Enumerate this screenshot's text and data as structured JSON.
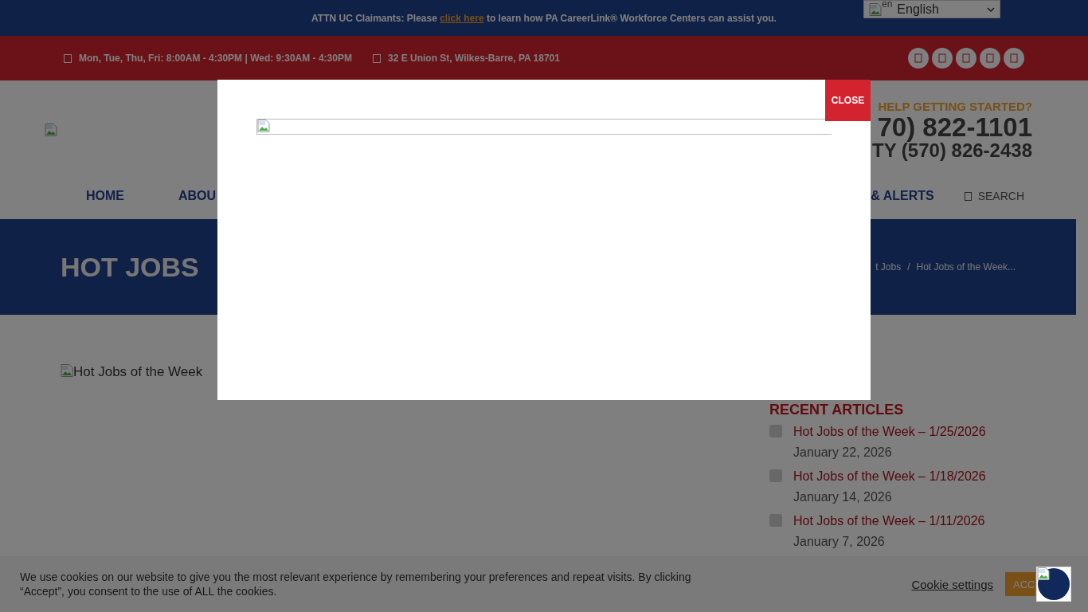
{
  "announcement": {
    "before": "ATTN UC Claimants: Please ",
    "link": "click here",
    "after": " to learn how PA CareerLink® Workforce Centers can assist you."
  },
  "language_select": {
    "flag_alt": "en",
    "value": "English"
  },
  "info_bar": {
    "hours": "Mon, Tue, Thu, Fri: 8:00AM - 4:30PM | Wed: 9:30AM - 4:30PM",
    "address": "32 E Union St, Wilkes-Barre, PA 18701"
  },
  "header": {
    "help": "HELP GETTING STARTED?",
    "phone": "70) 822-1101",
    "tty": "TY (570) 826-2438"
  },
  "nav": {
    "items": [
      {
        "label": "HOME"
      },
      {
        "label": "ABOU"
      }
    ],
    "right_items": [
      {
        "label": "& ALERTS"
      }
    ],
    "search": "SEARCH"
  },
  "page_title": "HOT JOBS",
  "breadcrumb": {
    "items": [
      "t Jobs",
      "Hot Jobs of the Week..."
    ],
    "separator": "/"
  },
  "article": {
    "image_alt": "Hot Jobs of the Week"
  },
  "sidebar": {
    "title": "RECENT ARTICLES",
    "articles": [
      {
        "title": "Hot Jobs of the Week – 1/25/2026",
        "date": "January 22, 2026"
      },
      {
        "title": "Hot Jobs of the Week – 1/18/2026",
        "date": "January 14, 2026"
      },
      {
        "title": "Hot Jobs of the Week – 1/11/2026",
        "date": "January 7, 2026"
      }
    ]
  },
  "cookie_bar": {
    "text": "We use cookies on our website to give you the most relevant experience by remembering your preferences and repeat visits. By clicking “Accept”, you consent to the use of ALL the cookies.",
    "settings": "Cookie settings",
    "accept": "ACC"
  },
  "modal": {
    "close": "CLOSE"
  }
}
